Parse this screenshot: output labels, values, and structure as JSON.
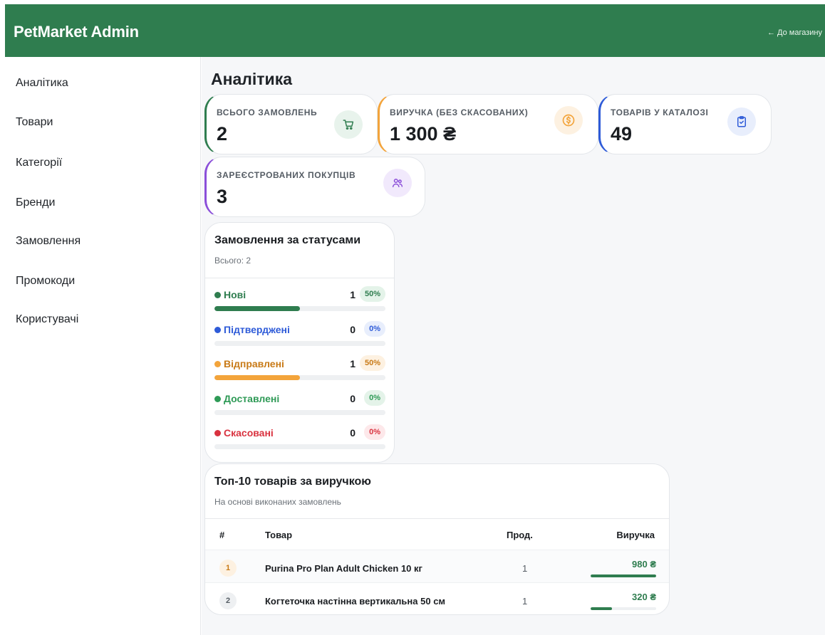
{
  "header": {
    "brand": "PetMarket Admin",
    "back_link": "← До магазину"
  },
  "sidebar": {
    "items": [
      {
        "label": "Аналітика"
      },
      {
        "label": "Товари"
      },
      {
        "label": "Категорії"
      },
      {
        "label": "Бренди"
      },
      {
        "label": "Замовлення"
      },
      {
        "label": "Промокоди"
      },
      {
        "label": "Користувачі"
      }
    ]
  },
  "page": {
    "title": "Аналітика"
  },
  "stats": [
    {
      "label": "ВСЬОГО ЗАМОВЛЕНЬ",
      "value": "2",
      "icon": "cart-icon",
      "accent": "#2f7d4f",
      "icon_bg": "#e8f3ec"
    },
    {
      "label": "ВИРУЧКА (БЕЗ СКАСОВАНИХ)",
      "value": "1 300 ₴",
      "icon": "dollar-coin-icon",
      "accent": "#f3a43b",
      "icon_bg": "#fdf1e1"
    },
    {
      "label": "ТОВАРІВ У КАТАЛОЗІ",
      "value": "49",
      "icon": "clipboard-check-icon",
      "accent": "#2e5bd8",
      "icon_bg": "#e8eefc"
    },
    {
      "label": "ЗАРЕЄСТРОВАНИХ ПОКУПЦІВ",
      "value": "3",
      "icon": "users-icon",
      "accent": "#8b4fd9",
      "icon_bg": "#f1e9fc"
    }
  ],
  "statuses_card": {
    "title": "Замовлення за статусами",
    "subtitle": "Всього: 2",
    "items": [
      {
        "name": "Нові",
        "count": "1",
        "pct": "50%",
        "fraction": 0.5,
        "color": "#2f7d4f",
        "pct_bg": "#e4f3e9"
      },
      {
        "name": "Підтверджені",
        "count": "0",
        "pct": "0%",
        "fraction": 0,
        "color": "#2e5bd8",
        "pct_bg": "#e8eefc"
      },
      {
        "name": "Відправлені",
        "count": "1",
        "pct": "50%",
        "fraction": 0.5,
        "color": "#f3a43b",
        "text_color": "#c87a16",
        "pct_bg": "#fdf1e1"
      },
      {
        "name": "Доставлені",
        "count": "0",
        "pct": "0%",
        "fraction": 0,
        "color": "#2e9a56",
        "pct_bg": "#e4f3e9"
      },
      {
        "name": "Скасовані",
        "count": "0",
        "pct": "0%",
        "fraction": 0,
        "color": "#d9323f",
        "pct_bg": "#fde8ea"
      }
    ]
  },
  "top_products": {
    "title": "Топ-10 товарів за виручкою",
    "subtitle": "На основі виконаних замовлень",
    "columns": {
      "rank": "#",
      "product": "Товар",
      "qty": "Прод.",
      "revenue": "Виручка"
    },
    "rows": [
      {
        "rank": "1",
        "name": "Purina Pro Plan Adult Chicken 10 кг",
        "qty": "1",
        "revenue": "980 ₴",
        "share": 1.0,
        "rank_bg": "#fdf1e1",
        "rank_color": "#c87a16"
      },
      {
        "rank": "2",
        "name": "Когтеточка настінна вертикальна 50 см",
        "qty": "1",
        "revenue": "320 ₴",
        "share": 0.33,
        "rank_bg": "#eef0f2",
        "rank_color": "#555c64"
      }
    ]
  }
}
